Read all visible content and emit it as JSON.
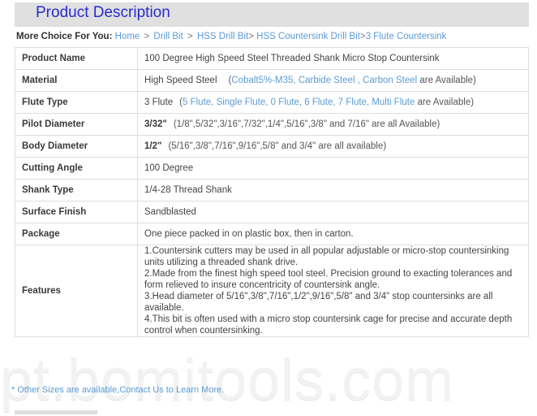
{
  "header": {
    "title": "Product Description"
  },
  "breadcrumb": {
    "label": "More Choice For You:",
    "items": [
      {
        "text": "Home",
        "sep": " > "
      },
      {
        "text": "Drill Bit",
        "sep": " > "
      },
      {
        "text": "HSS Drill Bit",
        "sep": "> "
      },
      {
        "text": "HSS Countersink Drill Bit",
        "sep": ">"
      },
      {
        "text": "3 Flute Countersink",
        "sep": ""
      }
    ]
  },
  "spec_table": {
    "rows": [
      {
        "key": "Product Name",
        "value": "100 Degree High Speed Steel Threaded Shank Micro Stop Countersink",
        "bold_value": "",
        "options": ""
      },
      {
        "key": "Material",
        "value": "High Speed Steel",
        "bold_value": "",
        "options_open": "(",
        "options_links": "Cobalt5%-M35, Carbide Steel , Carbon Steel",
        "options_tail": " are Available)"
      },
      {
        "key": "Flute Type",
        "value": "3 Flute",
        "bold_value": "",
        "options_open": "(",
        "options_links": "5 Flute, Single Flute, 0 Flute, 6 Flute, 7 Flute, Multi Flute",
        "options_tail": " are Available)"
      },
      {
        "key": "Pilot Diameter",
        "value": "",
        "bold_value": "3/32\"",
        "options_plain": "(1/8\",5/32\",3/16\",7/32\",1/4\",5/16\",3/8\" and 7/16\" are all Available)"
      },
      {
        "key": "Body Diameter",
        "value": "",
        "bold_value": "1/2\"",
        "options_plain": "(5/16\",3/8\",7/16\",9/16\",5/8\" and 3/4\" are all available)"
      },
      {
        "key": "Cutting Angle",
        "value": "100 Degree",
        "bold_value": "",
        "options": ""
      },
      {
        "key": "Shank Type",
        "value": "1/4-28 Thread Shank",
        "bold_value": "",
        "options": ""
      },
      {
        "key": "Surface Finish",
        "value": "Sandblasted",
        "bold_value": "",
        "options": ""
      },
      {
        "key": "Package",
        "value": "One piece packed in on plastic box, then in carton.",
        "bold_value": "",
        "options": ""
      }
    ],
    "features": {
      "key": "Features",
      "lines": [
        "1.Countersink cutters may be used in all popular adjustable or micro-stop countersinking units utilizing a threaded shank drive.",
        "2.Made from the finest high speed tool steel. Precision ground to exacting tolerances and form relieved to insure concentricity of countersink angle.",
        "3.Head diameter of 5/16\",3/8\",7/16\",1/2\",9/16\",5/8\" and 3/4\" stop countersinks are all available.",
        "4.This bit is often used with a micro stop countersink cage for precise and accurate depth control when countersinking."
      ]
    }
  },
  "footnote": {
    "text": "* Other Sizes are available,Contact Us to Learn More."
  },
  "watermark": {
    "text": "pt.bomitools.com"
  },
  "colors": {
    "title": "#2a2ad0",
    "title_band": "#e0e0e0",
    "link": "#5b9bd5",
    "body_text": "#444444",
    "key_bg": "#f7f7f7",
    "border": "#dddddd"
  }
}
